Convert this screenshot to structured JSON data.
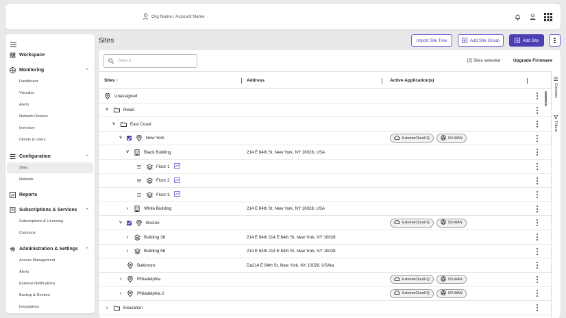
{
  "topbar": {
    "org_account": "Org Name / Account Name"
  },
  "sidebar": {
    "sections": [
      {
        "label": "Workspace",
        "icon": "workspace-icon"
      },
      {
        "label": "Monitoring",
        "icon": "monitoring-icon",
        "items": [
          "Dashboard",
          "Visualize",
          "Alerts",
          "Network Devices",
          "Inventory",
          "Clients & Users"
        ]
      },
      {
        "label": "Configuration",
        "icon": "configuration-icon",
        "items": [
          "Sites",
          "Network"
        ]
      },
      {
        "label": "Reports",
        "icon": "reports-icon"
      },
      {
        "label": "Subscriptions & Services",
        "icon": "subscriptions-icon",
        "items": [
          "Subscriptions & Licensing",
          "Contracts"
        ]
      },
      {
        "label": "Administration & Settings",
        "icon": "admin-gear-icon",
        "items": [
          "Access Management",
          "Alerts",
          "External Notifications",
          "Backup & Restore",
          "Integrations"
        ]
      }
    ],
    "active_item": "Sites"
  },
  "page": {
    "title": "Sites",
    "import_label": "Import Site Tree",
    "add_group_label": "Add Site Group",
    "add_site_label": "Add Site"
  },
  "toolbar": {
    "search_placeholder": "Search",
    "selection_info": "[2] Sites selected",
    "upgrade_label": "Upgrade Firmware"
  },
  "table": {
    "columns": [
      "Sites",
      "Address",
      "Active Application(s)"
    ],
    "side_tabs": [
      "Columns",
      "Filters"
    ],
    "app_labels": {
      "xiq": "ExtremeCloud IQ",
      "sdwan": "SD-WAN"
    },
    "rows": [
      {
        "name": "Unassigned",
        "address": "",
        "apps": false
      },
      {
        "name": "Retail",
        "address": "",
        "apps": false
      },
      {
        "name": "East Coast",
        "address": "",
        "apps": false
      },
      {
        "name": "New York",
        "address": "",
        "apps": true,
        "checked": true
      },
      {
        "name": "Black Building",
        "address": "214 E 84th St, New York, NY 10028, USA",
        "apps": false
      },
      {
        "name": "Floor 1",
        "address": "",
        "apps": false
      },
      {
        "name": "Floor 2",
        "address": "",
        "apps": false
      },
      {
        "name": "Floor 3",
        "address": "",
        "apps": false
      },
      {
        "name": "White Building",
        "address": "214 E 84th St, New York, NY 10028, USA",
        "apps": false
      },
      {
        "name": "Boston",
        "address": "",
        "apps": true,
        "checked": true
      },
      {
        "name": "Building 36",
        "address": "214 E 84th 214 E 84th St, New York, NY 10028",
        "apps": false
      },
      {
        "name": "Building 56",
        "address": "214 E 84th 214 E 84th St, New York, NY 10028",
        "apps": false
      },
      {
        "name": "Baltimore",
        "address": "Da214 E 84th St, New York, NY 10028, USAta",
        "apps": false
      },
      {
        "name": "Philadelphia",
        "address": "",
        "apps": true
      },
      {
        "name": "Philadelphia 2",
        "address": "",
        "apps": true
      },
      {
        "name": "Education",
        "address": "",
        "apps": false
      }
    ]
  }
}
